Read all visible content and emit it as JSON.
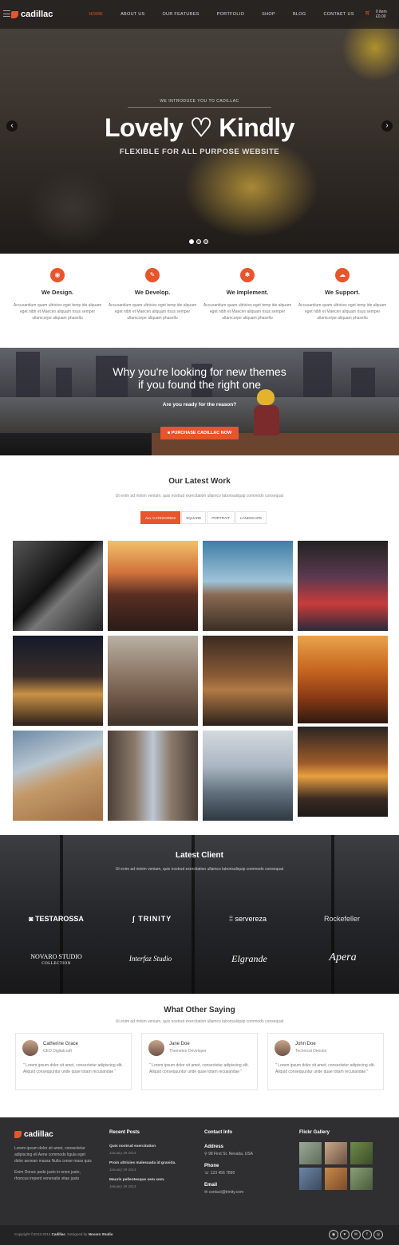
{
  "header": {
    "logo": "cadillac",
    "nav": [
      "HOME",
      "ABOUT US",
      "OUR FEATURES",
      "PORTFOLIO",
      "SHOP",
      "BLOG",
      "CONTACT US"
    ],
    "search_icon": "search-icon",
    "cart_count": "0 item",
    "cart_total": "£0.00"
  },
  "hero": {
    "kicker": "WE INTRODUCE YOU TO CADILLAC",
    "title_left": "Lovely",
    "heart": "♡",
    "title_right": "Kindly",
    "subtitle": "FLEXIBLE FOR ALL PURPOSE WEBSITE",
    "active_slide": 1,
    "slides": 3
  },
  "services": [
    {
      "icon": "◉",
      "title": "We Design.",
      "text": "Accusantium quam ultricies eget temp ide alquam eget nibh et Maecen aliquam risus semper ullamcorpe aliquam phasellu"
    },
    {
      "icon": "✎",
      "title": "We Develop.",
      "text": "Accusantium quam ultricies eget temp ide alquam eget nibh et Maecen aliquam risus semper ullamcorpe aliquam phasellu"
    },
    {
      "icon": "✱",
      "title": "We Implement.",
      "text": "Accusantium quam ultricies eget temp ide alquam eget nibh et Maecen aliquam risus semper ullamcorpe aliquam phasellu"
    },
    {
      "icon": "☁",
      "title": "We Support.",
      "text": "Accusantium quam ultricies eget temp ide alquam eget nibh et Maecen aliquam risus semper ullamcorpe aliquam phasellu"
    }
  ],
  "promo": {
    "title_line1": "Why you're looking for new themes",
    "title_line2": "if you found the right one",
    "subtitle": "Are you ready for the reason?",
    "button": "PURCHASE CADILLAC NOW"
  },
  "work": {
    "title": "Our Latest Work",
    "subtitle": "Ut enim ad minim veniam, quis nostrud exercitation ullamco laborisaliquip commodo consequat",
    "filters": [
      "ALL CATEGORIES",
      "SQUARE",
      "PORTRAIT",
      "LANDSCAPE"
    ]
  },
  "clients": {
    "title": "Latest Client",
    "subtitle": "Ut enim ad minim veniam, quis nostrud exercitation ullamco laborisaliquip commodo consequat",
    "logos": [
      "TESTAROSSA",
      "TRINITY",
      "servereza",
      "Rockefeller",
      "NOVARO STUDIO",
      "Interfaz Studio",
      "Elgrande",
      "Apera"
    ],
    "novaro_sub": "COLLECTION"
  },
  "testimonials": {
    "title": "What Other Saying",
    "subtitle": "Ut enim ad minim veniam, quis nostrud exercitation ullamco laborisaliquip commodo consequat",
    "items": [
      {
        "name": "Catherine Grace",
        "role": "CEO Digitalcraft",
        "quote": "\" Lorem ipsum dolor sit amet, consectetur adipiscing elit. Aliquid consequuntur unde quae totam recusandae \""
      },
      {
        "name": "Jane Doe",
        "role": "Themeteo Developer",
        "quote": "\" Lorem ipsum dolor sit amet, consectetur adipiscing elit. Aliquid consequuntur unde quae totam recusandae \""
      },
      {
        "name": "John Doe",
        "role": "Technical Director",
        "quote": "\" Lorem ipsum dolor sit amet, consectetur adipiscing elit. Aliquid consequuntur unde quae totam recusandae \""
      }
    ]
  },
  "footer": {
    "logo": "cadillac",
    "about": "Lorem ipsum dolor sit amet, consectetur adipiscing eli Aene commodo ligula eget dolor aenean massa Nulla conse mass quis",
    "about2": "Enim Donec pede justo in enen justo, rhoncus imperd venenatis vitae justo",
    "recent_title": "Recent Posts",
    "posts": [
      {
        "title": "Quis nostrud exercitation",
        "date": "January 29 2014"
      },
      {
        "title": "Proin ultricies malesuada id gravida.",
        "date": "January 29 2014"
      },
      {
        "title": "Mauris pellentesque sem sem.",
        "date": "January 29 2014"
      }
    ],
    "contact_title": "Contact Info",
    "address_label": "Address",
    "address": "98 First St. Nevada, USA",
    "phone_label": "Phone",
    "phone": "123 456 7890",
    "email_label": "Email",
    "email": "contact@trinity.com",
    "flickr_title": "Flickr Gallery",
    "copyright_prefix": "Copyright ©2013-2014",
    "copyright_brand": "Cadillac",
    "designed_by": ". Designed by",
    "designer": "Novaro Studio",
    "social": [
      "◉",
      "♥",
      "✉",
      "f",
      "◎"
    ]
  },
  "colors": {
    "accent": "#e8542b",
    "dark": "#2f2f31"
  }
}
